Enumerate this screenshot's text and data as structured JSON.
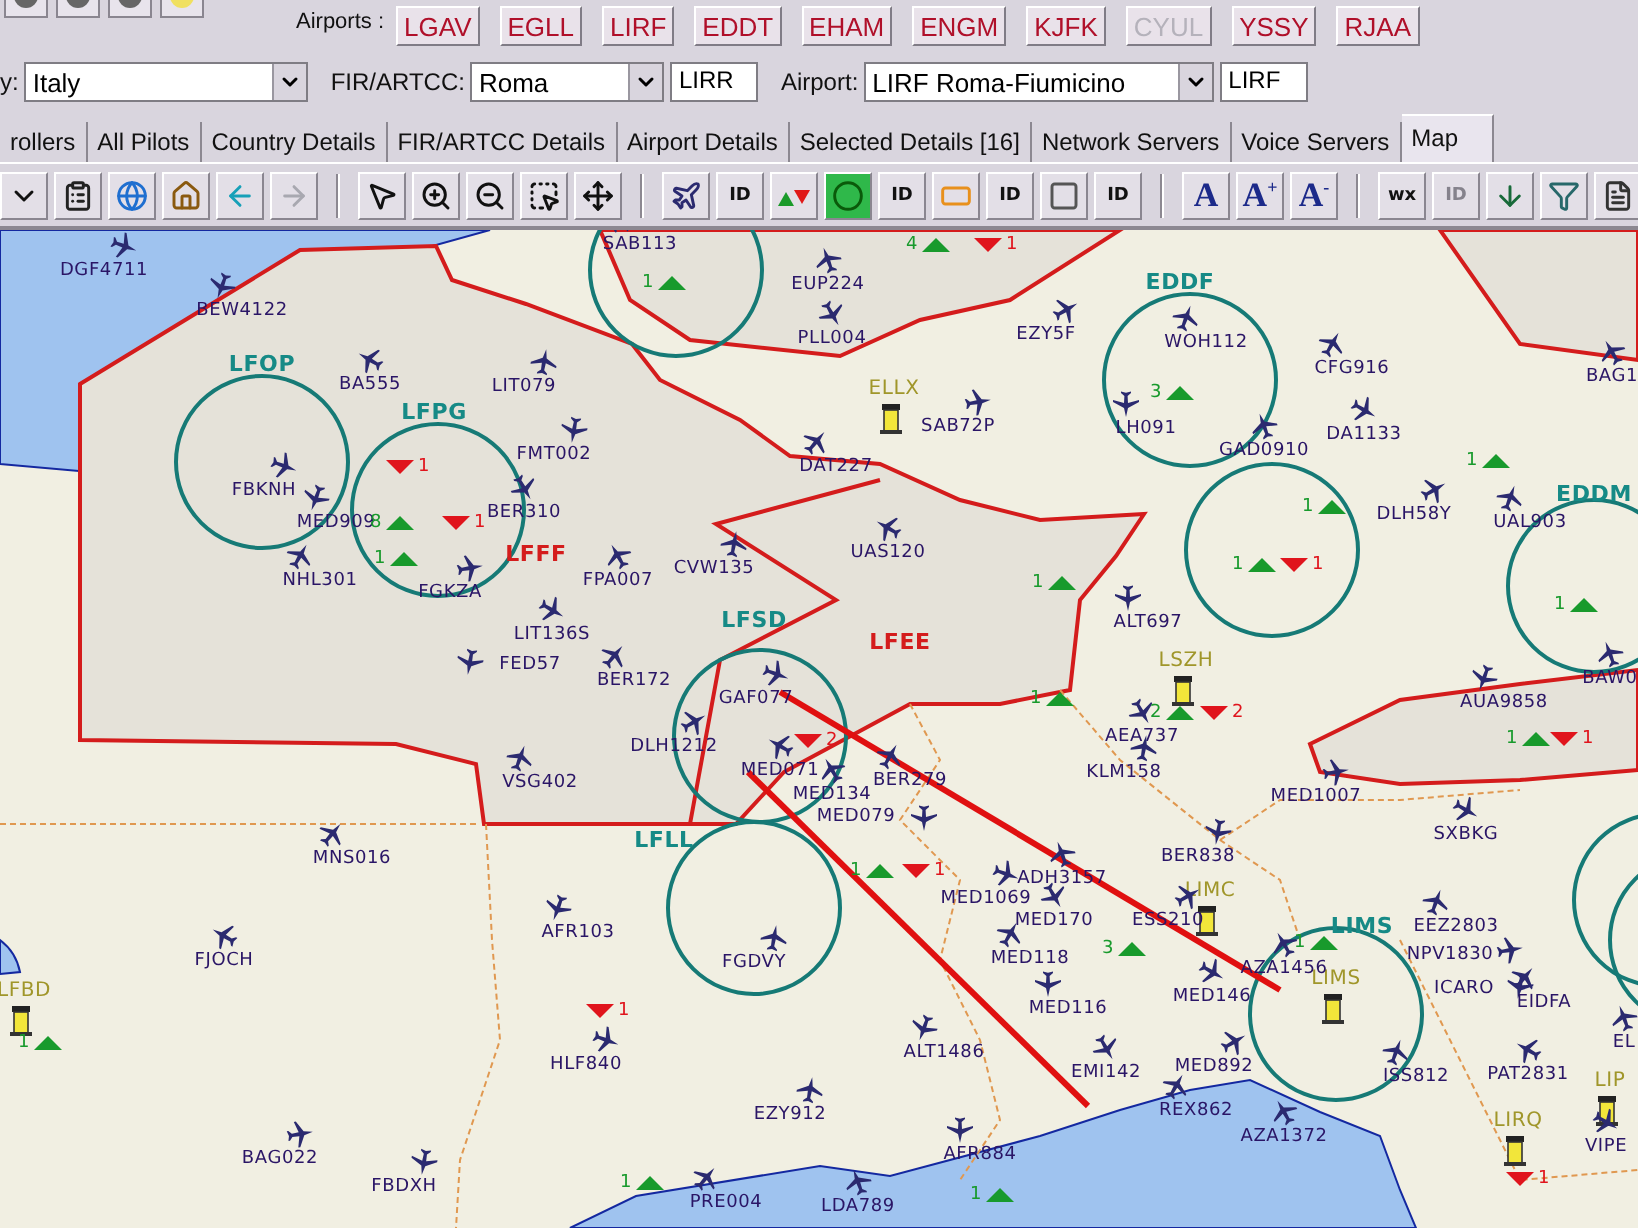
{
  "airports_bar": {
    "label": "Airports :",
    "buttons": [
      {
        "code": "LGAV",
        "disabled": false
      },
      {
        "code": "EGLL",
        "disabled": false
      },
      {
        "code": "LIRF",
        "disabled": false
      },
      {
        "code": "EDDT",
        "disabled": false
      },
      {
        "code": "EHAM",
        "disabled": false
      },
      {
        "code": "ENGM",
        "disabled": false
      },
      {
        "code": "KJFK",
        "disabled": false
      },
      {
        "code": "CYUL",
        "disabled": true
      },
      {
        "code": "YSSY",
        "disabled": false
      },
      {
        "code": "RJAA",
        "disabled": false
      }
    ]
  },
  "filters": [
    {
      "label": "y:",
      "value": "Italy"
    },
    {
      "label": "FIR/ARTCC:",
      "value": "Roma",
      "code": "LIRR"
    },
    {
      "label": "Airport:",
      "value": "LIRF Roma-Fiumicino",
      "code": "LIRF"
    }
  ],
  "tabs": [
    {
      "label": "rollers",
      "selected": false
    },
    {
      "label": "All Pilots",
      "selected": false
    },
    {
      "label": "Country Details",
      "selected": false
    },
    {
      "label": "FIR/ARTCC Details",
      "selected": false
    },
    {
      "label": "Airport Details",
      "selected": false
    },
    {
      "label": "Selected Details [16]",
      "selected": false
    },
    {
      "label": "Network Servers",
      "selected": false
    },
    {
      "label": "Voice Servers",
      "selected": false
    },
    {
      "label": "Map",
      "selected": true
    }
  ],
  "toolbar": [
    {
      "label": "ID",
      "disabled": false
    },
    {
      "label": "ID",
      "disabled": false
    },
    {
      "label": "ID",
      "disabled": false
    },
    {
      "label": "ID",
      "disabled": false
    },
    {
      "label": "A",
      "disabled": false
    },
    {
      "label": "A$^{+}$",
      "disabled": false
    },
    {
      "label": "A$^{-}$",
      "disabled": false
    },
    {
      "label": "wx",
      "disabled": false
    },
    {
      "label": "ID",
      "disabled": true
    }
  ],
  "map": {
    "fir_labels": [
      {
        "code": "LFFF"
      },
      {
        "code": "LFEE"
      }
    ],
    "airports": [
      {
        "code": "LFOP",
        "kind": "circle"
      },
      {
        "code": "LFPG",
        "kind": "circle"
      },
      {
        "code": "LFSD",
        "kind": "circle"
      },
      {
        "code": "EDDF",
        "kind": "circle"
      },
      {
        "code": "EDDM",
        "kind": "circle"
      },
      {
        "code": "LFLL",
        "kind": "circle"
      },
      {
        "code": "LIMS",
        "kind": "circle"
      },
      {
        "code": "ELLX",
        "kind": "tower"
      },
      {
        "code": "LSZH",
        "kind": "tower"
      },
      {
        "code": "LFBD",
        "kind": "tower"
      },
      {
        "code": "LIMC",
        "kind": "tower"
      },
      {
        "code": "LIMS",
        "kind": "tower"
      },
      {
        "code": "LIRQ",
        "kind": "tower"
      },
      {
        "code": "LIP",
        "kind": "tower"
      }
    ],
    "aircraft": [
      {
        "callsign": "SAB113"
      },
      {
        "callsign": "EUP224"
      },
      {
        "callsign": "DGF4711"
      },
      {
        "callsign": "BEW4122"
      },
      {
        "callsign": "PLL004"
      },
      {
        "callsign": "EZY5F"
      },
      {
        "callsign": "WOH112"
      },
      {
        "callsign": "BA555"
      },
      {
        "callsign": "LIT079"
      },
      {
        "callsign": "CFG916"
      },
      {
        "callsign": "BAG1"
      },
      {
        "callsign": "SAB72P"
      },
      {
        "callsign": "LH091"
      },
      {
        "callsign": "DA1133"
      },
      {
        "callsign": "FMT002"
      },
      {
        "callsign": "DAT227"
      },
      {
        "callsign": "GAD0910"
      },
      {
        "callsign": "FBKNH"
      },
      {
        "callsign": "MED909"
      },
      {
        "callsign": "BER310"
      },
      {
        "callsign": "DLH58Y"
      },
      {
        "callsign": "UAL903"
      },
      {
        "callsign": "UAS120"
      },
      {
        "callsign": "CVW135"
      },
      {
        "callsign": "NHL301"
      },
      {
        "callsign": "FPA007"
      },
      {
        "callsign": "FGKZA"
      },
      {
        "callsign": "ALT697"
      },
      {
        "callsign": "LIT136S"
      },
      {
        "callsign": "FED57"
      },
      {
        "callsign": "BER172"
      },
      {
        "callsign": "BAW0"
      },
      {
        "callsign": "GAF077"
      },
      {
        "callsign": "AUA9858"
      },
      {
        "callsign": "AEA737"
      },
      {
        "callsign": "DLH1212"
      },
      {
        "callsign": "VSG402"
      },
      {
        "callsign": "MED071"
      },
      {
        "callsign": "KLM158"
      },
      {
        "callsign": "BER279"
      },
      {
        "callsign": "MED134"
      },
      {
        "callsign": "MED1007"
      },
      {
        "callsign": "MED079"
      },
      {
        "callsign": "SXBKG"
      },
      {
        "callsign": "BER838"
      },
      {
        "callsign": "MNS016"
      },
      {
        "callsign": "ADH3157"
      },
      {
        "callsign": "MED1069"
      },
      {
        "callsign": "AFR103"
      },
      {
        "callsign": "MED170"
      },
      {
        "callsign": "ESS210"
      },
      {
        "callsign": "EEZ2803"
      },
      {
        "callsign": "FJOCH"
      },
      {
        "callsign": "FGDVY"
      },
      {
        "callsign": "MED118"
      },
      {
        "callsign": "AZA1456"
      },
      {
        "callsign": "NPV1830"
      },
      {
        "callsign": "MED116"
      },
      {
        "callsign": "MED146"
      },
      {
        "callsign": "ICARO"
      },
      {
        "callsign": "EIDFA"
      },
      {
        "callsign": "EL"
      },
      {
        "callsign": "HLF840"
      },
      {
        "callsign": "ALT1486"
      },
      {
        "callsign": "EMI142"
      },
      {
        "callsign": "MED892"
      },
      {
        "callsign": "ISS812"
      },
      {
        "callsign": "PAT2831"
      },
      {
        "callsign": "EZY912"
      },
      {
        "callsign": "REX862"
      },
      {
        "callsign": "AZA1372"
      },
      {
        "callsign": "BAG022"
      },
      {
        "callsign": "AFR884"
      },
      {
        "callsign": "VIPE"
      },
      {
        "callsign": "FBDXH"
      },
      {
        "callsign": "PRE004"
      },
      {
        "callsign": "LDA789"
      }
    ],
    "counters": [
      {
        "kind": "departures",
        "count": "8"
      },
      {
        "kind": "arrivals",
        "count": "1"
      },
      {
        "kind": "departures",
        "count": "1"
      },
      {
        "kind": "arrivals",
        "count": "1"
      },
      {
        "kind": "departures",
        "count": "1"
      },
      {
        "kind": "departures",
        "count": "4"
      },
      {
        "kind": "arrivals",
        "count": "1"
      },
      {
        "kind": "departures",
        "count": "3"
      },
      {
        "kind": "departures",
        "count": "1"
      },
      {
        "kind": "departures",
        "count": "1"
      },
      {
        "kind": "departures",
        "count": "1"
      },
      {
        "kind": "arrivals",
        "count": "1"
      },
      {
        "kind": "departures",
        "count": "1"
      },
      {
        "kind": "departures",
        "count": "1"
      },
      {
        "kind": "departures",
        "count": "1"
      },
      {
        "kind": "departures",
        "count": "2"
      },
      {
        "kind": "arrivals",
        "count": "2"
      },
      {
        "kind": "departures",
        "count": "1"
      },
      {
        "kind": "arrivals",
        "count": "1"
      },
      {
        "kind": "departures",
        "count": "1"
      },
      {
        "kind": "arrivals",
        "count": "1"
      },
      {
        "kind": "arrivals",
        "count": "2"
      },
      {
        "kind": "arrivals",
        "count": "1"
      },
      {
        "kind": "departures",
        "count": "3"
      },
      {
        "kind": "departures",
        "count": "1"
      },
      {
        "kind": "departures",
        "count": "1"
      },
      {
        "kind": "departures",
        "count": "1"
      },
      {
        "kind": "departures",
        "count": "1"
      },
      {
        "kind": "arrivals",
        "count": "1"
      }
    ]
  }
}
